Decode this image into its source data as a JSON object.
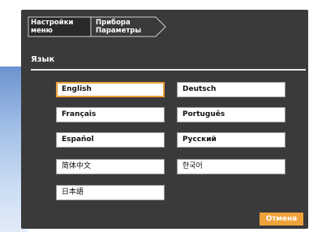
{
  "breadcrumb": {
    "items": [
      {
        "label": "Настройки\nменю"
      },
      {
        "label": "Прибора\nПараметры"
      }
    ]
  },
  "section": {
    "title": "Язык"
  },
  "languages": [
    {
      "label": "English",
      "selected": true
    },
    {
      "label": "Deutsch"
    },
    {
      "label": "Français"
    },
    {
      "label": "Português"
    },
    {
      "label": "Español"
    },
    {
      "label": "Русский"
    },
    {
      "label": "简体中文"
    },
    {
      "label": "한국어"
    },
    {
      "label": "日本語"
    }
  ],
  "footer": {
    "cancel_label": "Отмена"
  },
  "colors": {
    "accent": "#f0a23a",
    "panel": "#3a3a3a",
    "backdrop": "#9fbde6"
  }
}
